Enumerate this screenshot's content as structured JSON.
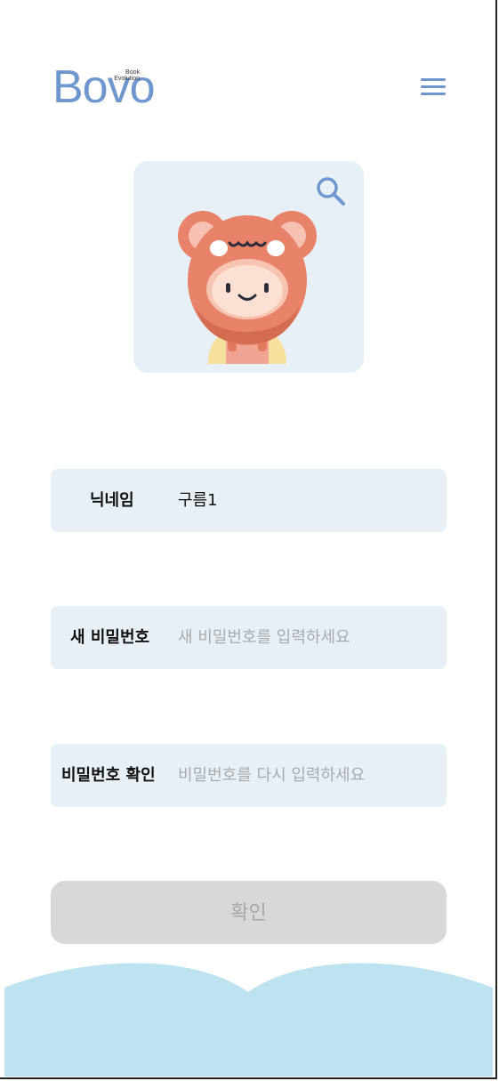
{
  "header": {
    "logo_text": "Bovo",
    "logo_sub_line1": "Book",
    "logo_sub_line2": "Evolution",
    "menu_icon": "hamburger-menu-icon"
  },
  "profile": {
    "avatar_icon": "bear-costume-child-avatar",
    "search_icon": "magnifier-icon"
  },
  "form": {
    "nickname_label": "닉네임",
    "nickname_value": "구름1",
    "new_password_label": "새 비밀번호",
    "new_password_placeholder": "새 비밀번호를 입력하세요",
    "confirm_password_label": "비밀번호 확인",
    "confirm_password_placeholder": "비밀번호를 다시 입력하세요",
    "submit_label": "확인"
  },
  "colors": {
    "accent": "#6f97cf",
    "field_bg": "#e7f0f6",
    "button_disabled_bg": "#d8d8d8",
    "bottom_wave": "#bde3f0"
  }
}
